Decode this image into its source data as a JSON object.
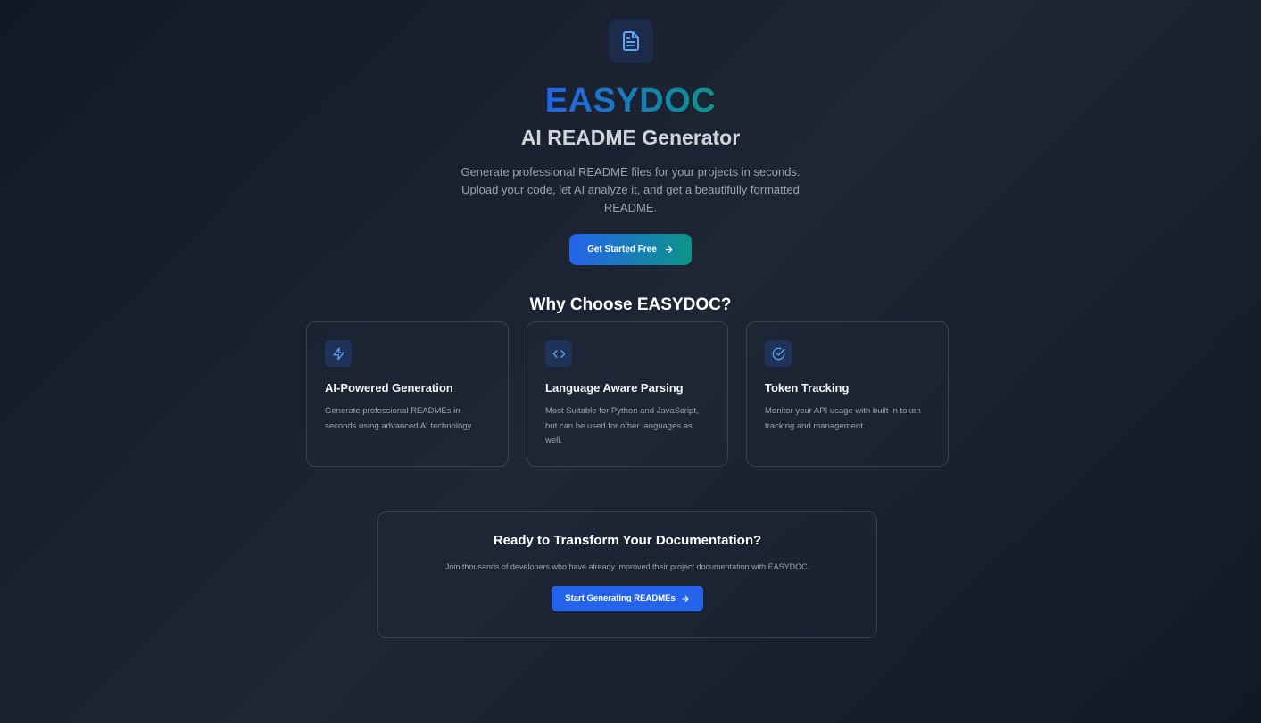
{
  "hero": {
    "logo_icon": "file-text-icon",
    "brand": "EASYDOC",
    "subtitle": "AI README Generator",
    "description": "Generate professional README files for your projects in seconds. Upload your code, let AI analyze it, and get a beautifully formatted README.",
    "cta_label": "Get Started Free",
    "cta_icon": "arrow-right-icon"
  },
  "features": {
    "title": "Why Choose EASYDOC?",
    "items": [
      {
        "icon": "zap-icon",
        "title": "AI-Powered Generation",
        "description": "Generate professional READMEs in seconds using advanced AI technology."
      },
      {
        "icon": "code-icon",
        "title": "Language Aware Parsing",
        "description": "Most Suitable for Python and JavaScript, but can be used for other languages as well."
      },
      {
        "icon": "check-circle-icon",
        "title": "Token Tracking",
        "description": "Monitor your API usage with built-in token tracking and management."
      }
    ]
  },
  "ready": {
    "title": "Ready to Transform Your Documentation?",
    "description": "Join thousands of developers who have already improved their project documentation with EASYDOC.",
    "button_label": "Start Generating READMEs",
    "button_icon": "arrow-right-icon"
  },
  "colors": {
    "primary": "#2563eb",
    "accent": "#0d9488",
    "background": "#111827",
    "card_border": "#374151",
    "icon_blue": "#60a5fa"
  }
}
